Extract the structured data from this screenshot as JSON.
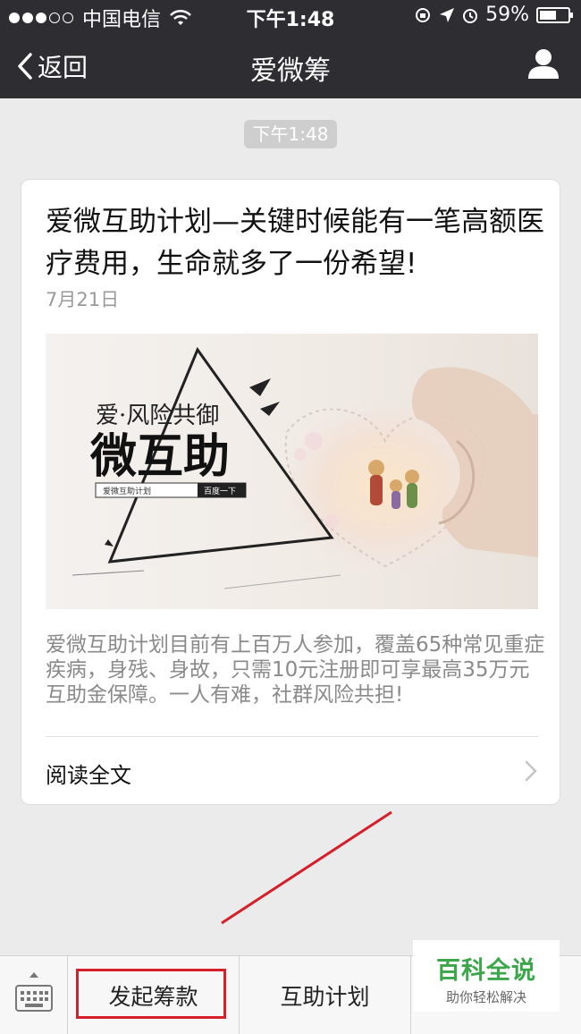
{
  "status_bar": {
    "carrier": "中国电信",
    "time": "下午1:48",
    "battery": "59%",
    "battery_level": 0.59
  },
  "nav": {
    "back_label": "返回",
    "title": "爱微筹"
  },
  "chat": {
    "timestamp": "下午1:48"
  },
  "article": {
    "title": "爱微互助计划—关键时候能有一笔高额医疗费用，生命就多了一份希望!",
    "date": "7月21日",
    "image_text": {
      "line1": "爱·风险共御",
      "line2": "微互助",
      "tag1": "爱微互助计划",
      "tag2": "百度一下"
    },
    "description": "爱微互助计划目前有上百万人参加，覆盖65种常见重症疾病，身残、身故，只需10元注册即可享最高35万元互助金保障。一人有难，社群风险共担!",
    "read_more": "阅读全文"
  },
  "bottom_menu": {
    "items": [
      "发起筹款",
      "互助计划",
      ""
    ]
  },
  "watermark": {
    "main": "百科全说",
    "sub": "助你轻松解决"
  },
  "colors": {
    "nav_bg": "#2e2e32",
    "page_bg": "#ebebeb",
    "highlight": "#d3202a",
    "watermark_green": "#3ca64a"
  }
}
